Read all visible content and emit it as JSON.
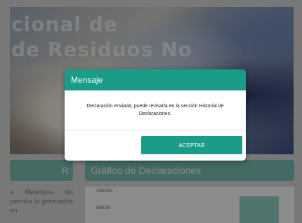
{
  "background": {
    "hero": {
      "line1": "cional de",
      "line2": "de Residuos No"
    },
    "left_section": {
      "heading": "R",
      "text": "e Residuos No   permita la generados en"
    },
    "right_section": {
      "heading": "Gráfico de Declaraciones",
      "tick_labels": [
        "1000000",
        "800000"
      ]
    }
  },
  "modal": {
    "title": "Mensaje",
    "message": "Declaración enviada, puede revisarla en la sección Historial de Declaraciones.",
    "accept_label": "ACEPTAR"
  },
  "colors": {
    "accent": "#1a9c88"
  }
}
